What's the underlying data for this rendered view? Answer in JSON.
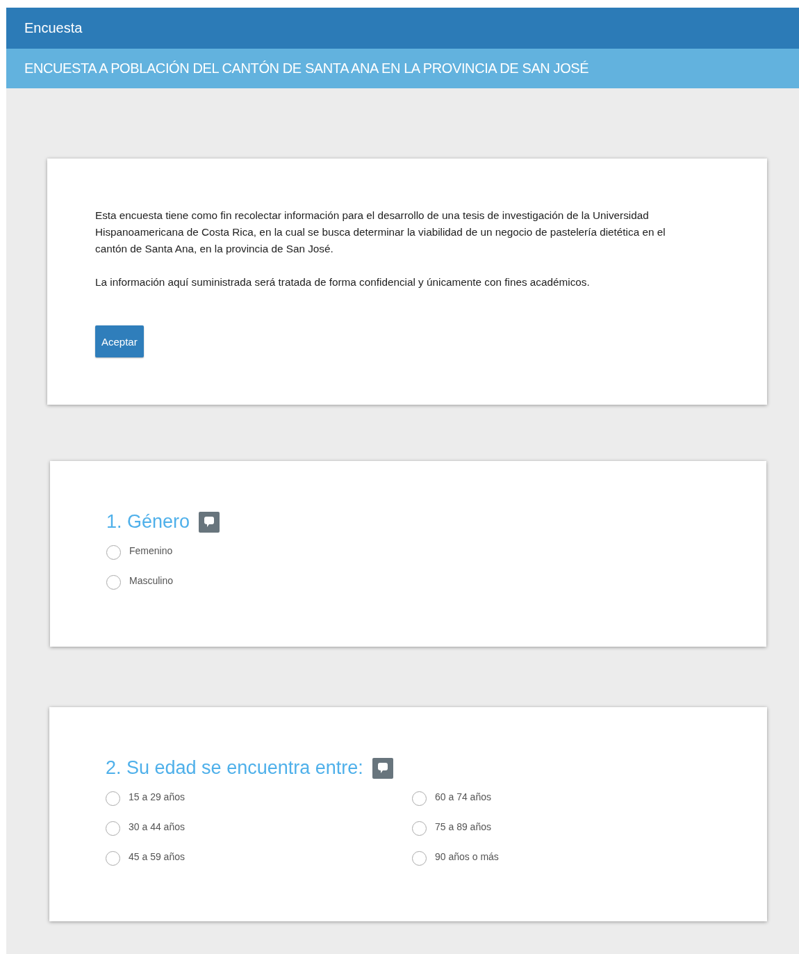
{
  "header": {
    "title": "Encuesta",
    "subtitle": "ENCUESTA A POBLACIÓN DEL CANTÓN DE SANTA ANA EN LA PROVINCIA DE SAN JOSÉ"
  },
  "intro": {
    "paragraphs": [
      "Esta encuesta tiene como fin recolectar información para el desarrollo de una tesis de investigación de la Universidad Hispanoamericana de Costa Rica, en la cual se busca determinar la viabilidad de un negocio de pastelería dietética en el cantón de Santa Ana, en la provincia de San José.",
      "La información aquí suministrada será tratada de forma confidencial y únicamente con fines académicos."
    ],
    "button": "Aceptar"
  },
  "questions": [
    {
      "title": "1. Género",
      "kind": "single_column",
      "options": [
        {
          "label": "Femenino",
          "selected": false
        },
        {
          "label": "Masculino",
          "selected": false
        }
      ]
    },
    {
      "title": "2. Su edad se encuentra entre:",
      "kind": "two_column",
      "options": [
        {
          "label": "15 a 29 años",
          "selected": false
        },
        {
          "label": "30 a 44 años",
          "selected": false
        },
        {
          "label": "45 a 59 años",
          "selected": false
        },
        {
          "label": "60 a 74 años",
          "selected": false
        },
        {
          "label": "75 a 89 años",
          "selected": false
        },
        {
          "label": "90 años o más",
          "selected": false
        }
      ]
    }
  ]
}
